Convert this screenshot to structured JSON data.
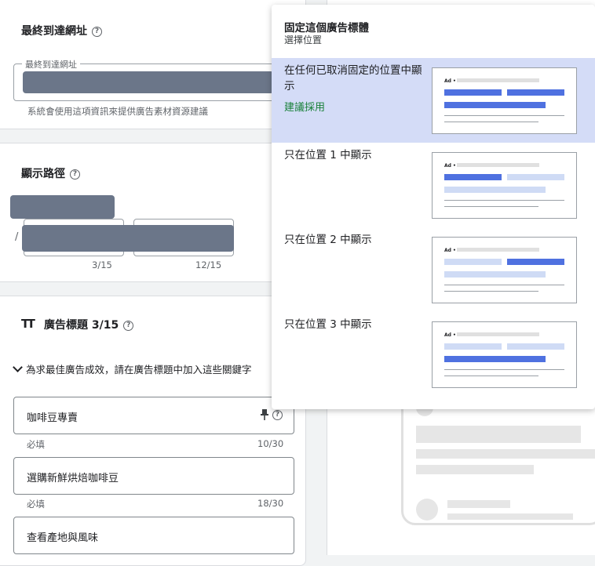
{
  "final_url": {
    "title": "最終到達網址",
    "help": "?",
    "field_label": "最終到達網址",
    "hint": "系統會使用這項資訊來提供廣告素材資源建議"
  },
  "display_path": {
    "title": "顯示路徑",
    "help": "?",
    "slash": "/",
    "path1_counter": "3/15",
    "path2_counter": "12/15"
  },
  "headlines": {
    "icon": "TT",
    "title": "廣告標題 3/15",
    "help": "?",
    "suggest": "為求最佳廣告成效，請在廣告標題中加入這些關鍵字",
    "items": [
      {
        "text": "咖啡豆專賣",
        "req": "必填",
        "count": "10/30"
      },
      {
        "text": "選購新鮮烘焙咖啡豆",
        "req": "必填",
        "count": "18/30"
      },
      {
        "text": "查看產地與風味"
      }
    ]
  },
  "pin_popup": {
    "title": "固定這個廣告標體",
    "subtitle": "選擇位置",
    "options": [
      {
        "label": "在任何已取消固定的位置中顯示",
        "recommended": "建議採用",
        "selected": true
      },
      {
        "label": "只在位置 1 中顯示"
      },
      {
        "label": "只在位置 2 中顯示"
      },
      {
        "label": "只在位置 3 中顯示"
      }
    ],
    "thumb_ad": "Ad •"
  },
  "colors": {
    "accent": "#4f71e0",
    "light": "#cfdbf5",
    "selected_bg": "#d4dcf7",
    "recommend": "#188038"
  }
}
